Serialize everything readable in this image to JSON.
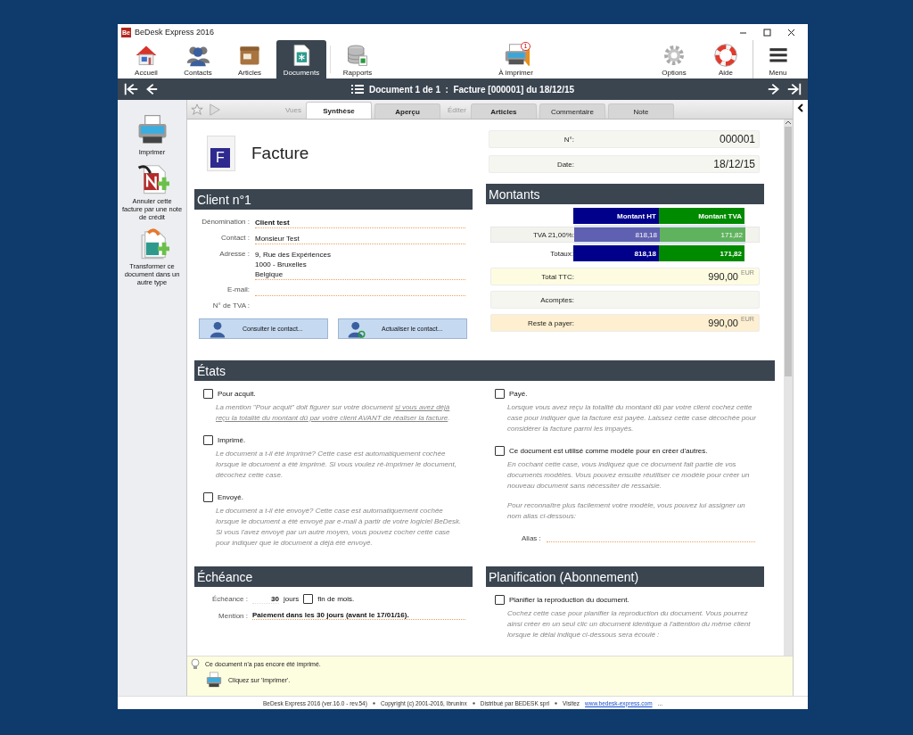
{
  "window": {
    "title": "BeDesk Express 2016",
    "app_badge": "Be"
  },
  "toolbar": {
    "items": [
      {
        "label": "Accueil",
        "kind": "home",
        "selected": false
      },
      {
        "label": "Contacts",
        "kind": "people",
        "selected": false
      },
      {
        "label": "Articles",
        "kind": "box",
        "selected": false
      },
      {
        "label": "Documents",
        "kind": "document",
        "selected": true
      },
      {
        "label": "Rapports",
        "kind": "database",
        "selected": false
      }
    ],
    "print_queue": {
      "label": "À imprimer",
      "badge": "1"
    },
    "right_items": [
      {
        "label": "Options",
        "kind": "gear"
      },
      {
        "label": "Aide",
        "kind": "lifebuoy"
      },
      {
        "label": "Menu",
        "kind": "menu"
      }
    ]
  },
  "navbar": {
    "title": "Document 1 de 1  :  Facture [000001] du 18/12/15"
  },
  "sidebar": {
    "actions": [
      {
        "label": "Imprimer",
        "kind": "printer"
      },
      {
        "label": "Annuler cette facture par une note de crédit",
        "kind": "credit-note"
      },
      {
        "label": "Transformer ce document dans un autre type",
        "kind": "transform"
      }
    ]
  },
  "tabs": {
    "groups": [
      {
        "label": "Vues",
        "tabs": [
          {
            "label": "Synthèse",
            "selected": true,
            "bold": true
          },
          {
            "label": "Aperçu",
            "selected": false,
            "bold": true
          }
        ]
      },
      {
        "label": "Éditer",
        "tabs": [
          {
            "label": "Articles",
            "selected": false,
            "bold": true
          },
          {
            "label": "Commentaire",
            "selected": false,
            "bold": false
          },
          {
            "label": "Note",
            "selected": false,
            "bold": false
          }
        ]
      }
    ]
  },
  "document": {
    "icon_letter": "F",
    "title": "Facture",
    "fields": [
      {
        "label": "N°:",
        "value": "000001"
      },
      {
        "label": "Date:",
        "value": "18/12/15"
      }
    ]
  },
  "client": {
    "heading": "Client n°1",
    "fields": [
      {
        "label": "Dénomination :",
        "value": "Client test",
        "kind": "field",
        "bold": true
      },
      {
        "label": "Contact :",
        "value": "Monsieur Test",
        "kind": "field",
        "bold": false
      },
      {
        "label": "Adresse :",
        "value": "9, Rue des Expériences\n1000 - Bruxelles\nBelgique",
        "kind": "field",
        "bold": false
      },
      {
        "label": "E-mail:",
        "kind": "field"
      },
      {
        "label": "N° de TVA :",
        "kind": "text"
      }
    ],
    "buttons": [
      {
        "label": "Consulter le contact...",
        "kind": "person"
      },
      {
        "label": "Actualiser le contact...",
        "kind": "person-refresh"
      }
    ]
  },
  "amounts": {
    "heading": "Montants",
    "columns": [
      {
        "label": "Montant HT",
        "color": "#00008b"
      },
      {
        "label": "Montant TVA",
        "color": "#008a00"
      }
    ],
    "rows": [
      {
        "label": "TVA 21,00%:",
        "kind": "rate",
        "values": [
          "818,18",
          "171,82"
        ]
      },
      {
        "label": "Totaux:",
        "kind": "total",
        "values": [
          "818,18",
          "171,82"
        ]
      }
    ],
    "summary": [
      {
        "label": "Total TTC:",
        "value": "990,00",
        "currency": "EUR",
        "kind": "total"
      },
      {
        "label": "Acomptes:",
        "kind": "plain"
      },
      {
        "label": "Reste à payer:",
        "value": "990,00",
        "currency": "EUR",
        "kind": "due"
      }
    ]
  },
  "states": {
    "heading": "États",
    "left": [
      {
        "label": "Pour acquit.",
        "checked": false,
        "description": [
          {
            "text": "La mention \"Pour acquit\" doit figurer sur votre document ",
            "underline": false
          },
          {
            "text": "si vous avez déjà reçu la totalité du montant dû par votre client AVANT de réaliser la facture",
            "underline": true
          },
          {
            "text": ".",
            "underline": false
          }
        ]
      },
      {
        "label": "Imprimé.",
        "checked": false,
        "description": [
          {
            "text": "Le document a t-il été imprimé? Cette case est automatiquement cochée lorsque le document a été imprimé. Si vous voulez ré-imprimer le document, décochez cette case.",
            "underline": false
          }
        ]
      },
      {
        "label": "Envoyé.",
        "checked": false,
        "description": [
          {
            "text": "Le document a t-il été envoyé? Cette case est automatiquement cochée lorsque le document a été envoyé par e-mail à partir de votre logiciel BeDesk. Si vous l'avez envoyé par un autre moyen, vous pouvez cocher cette case pour indiquer que le document a déjà été envoyé.",
            "underline": false
          }
        ]
      }
    ],
    "right": [
      {
        "label": "Payé.",
        "checked": false,
        "description": [
          {
            "text": "Lorsque vous avez reçu la totalité du montant dû par votre client cochez cette case pour indiquer que la facture est payée. Laissez cette case décochée pour considérer la facture parmi les impayés.",
            "underline": false
          }
        ]
      },
      {
        "label": "Ce document est utilisé comme modèle pour en créer d'autres.",
        "checked": false,
        "description": [
          {
            "text": "En cochant cette case, vous indiquez que ce document fait partie de vos documents modèles. Vous pouvez ensuite réutiliser ce modèle pour créer un nouveau document sans nécessiter de ressaisie.",
            "underline": false
          }
        ],
        "extra": "Pour reconnaître plus facilement votre modèle, vous pouvez lui assigner un nom alias ci-dessous:",
        "alias_label": "Alias :"
      }
    ]
  },
  "due": {
    "heading": "Échéance",
    "term_label": "Échéance :",
    "term_value": "30",
    "term_unit": "jours",
    "end_of_month": {
      "label": "fin de mois.",
      "checked": false
    },
    "mention_label": "Mention :",
    "mention_value": "Paiement dans les 30 jours (avant le 17/01/16)."
  },
  "planning": {
    "heading": "Planification (Abonnement)",
    "option": {
      "label": "Planifier la reproduction du document.",
      "checked": false
    },
    "description": "Cochez cette case pour planifier la reproduction du document. Vous pourrez ainsi créer en un seul clic un document identique à l'attention du même client lorsque le délai indiqué ci-dessous sera écoulé :"
  },
  "hint": {
    "message": "Ce document n'a pas encore été imprimé.",
    "action": "Cliquez sur 'Imprimer'."
  },
  "footer": {
    "parts": [
      "BeDesk Express 2016 (ver.16.0 - rev.54)",
      "Copyright (c) 2001-2016, Ibruninx",
      "Distribué par BEDESK sprl",
      "Visitez"
    ],
    "link": "www.bedesk-express.com",
    "tail": "..."
  }
}
